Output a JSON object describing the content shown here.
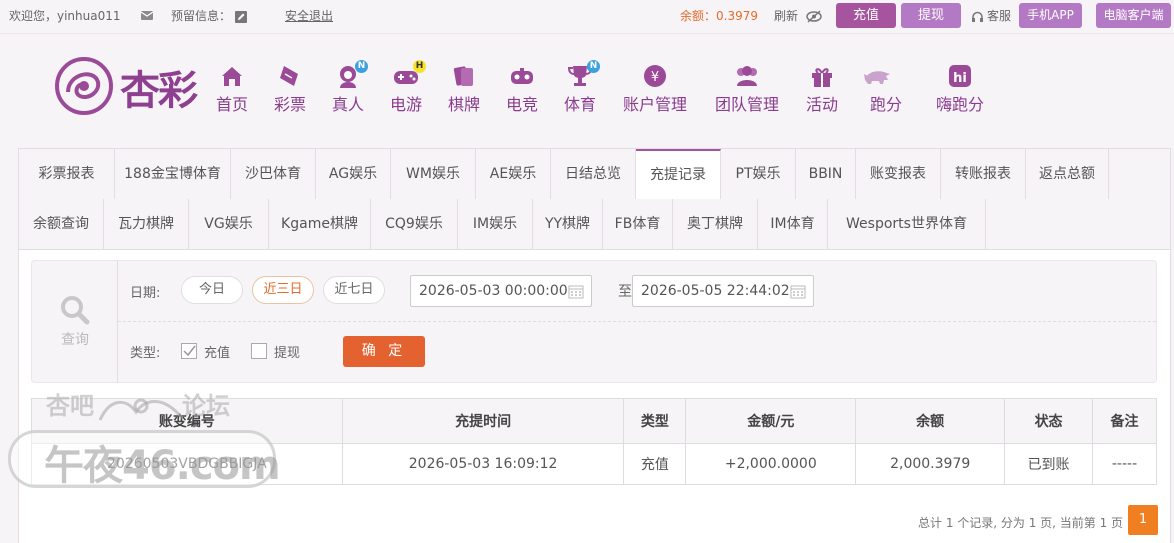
{
  "topbar": {
    "welcome": "欢迎您，yinhua011",
    "reserved_info": "预留信息：",
    "logout": "安全退出",
    "balance_label": "余额：",
    "balance_value": "0.3979",
    "refresh": "刷新",
    "deposit_btn": "充值",
    "withdraw_btn": "提现",
    "service": "客服",
    "mobile_app": "手机APP",
    "pc_client": "电脑客户端"
  },
  "brand": {
    "name": "杏彩"
  },
  "nav": [
    {
      "label": "首页",
      "icon": "home-icon"
    },
    {
      "label": "彩票",
      "icon": "ticket-icon"
    },
    {
      "label": "真人",
      "icon": "dealer-icon",
      "badge": "N"
    },
    {
      "label": "电游",
      "icon": "gamepad-icon",
      "badge": "H"
    },
    {
      "label": "棋牌",
      "icon": "cards-icon"
    },
    {
      "label": "电竞",
      "icon": "controller-icon"
    },
    {
      "label": "体育",
      "icon": "trophy-icon",
      "badge": "N"
    },
    {
      "label": "账户管理",
      "icon": "yen-coin-icon"
    },
    {
      "label": "团队管理",
      "icon": "team-icon"
    },
    {
      "label": "活动",
      "icon": "gift-icon"
    },
    {
      "label": "跑分",
      "icon": "rhino-icon"
    },
    {
      "label": "嗨跑分",
      "icon": "hi-icon"
    }
  ],
  "tabs_row1": [
    "彩票报表",
    "188金宝博体育",
    "沙巴体育",
    "AG娱乐",
    "WM娱乐",
    "AE娱乐",
    "日结总览",
    "充提记录",
    "PT娱乐",
    "BBIN",
    "账变报表",
    "转账报表",
    "返点总额"
  ],
  "tabs_row2": [
    "余额查询",
    "瓦力棋牌",
    "VG娱乐",
    "Kgame棋牌",
    "CQ9娱乐",
    "IM娱乐",
    "YY棋牌",
    "FB体育",
    "奥丁棋牌",
    "IM体育",
    "Wesports世界体育"
  ],
  "active_tab": "充提记录",
  "filter": {
    "query_label": "查询",
    "date_label": "日期:",
    "quick_dates": [
      "今日",
      "近三日",
      "近七日"
    ],
    "active_quick": "近三日",
    "start": "2026-05-03 00:00:00",
    "to": "至",
    "end": "2026-05-05 22:44:02",
    "type_label": "类型:",
    "type_options": [
      {
        "label": "充值",
        "checked": true
      },
      {
        "label": "提现",
        "checked": false
      }
    ],
    "confirm": "确 定"
  },
  "table": {
    "headers": [
      "账变编号",
      "充提时间",
      "类型",
      "金额/元",
      "余额",
      "状态",
      "备注"
    ],
    "rows": [
      [
        "20260503VBDGBBIGJA",
        "2026-05-03 16:09:12",
        "充值",
        "+2,000.0000",
        "2,000.3979",
        "已到账",
        "-----"
      ]
    ]
  },
  "pagination": {
    "info": "总计 1 个记录, 分为 1 页, 当前第 1 页",
    "current": "1"
  },
  "watermark": {
    "top_left": "杏吧",
    "top_right": "论坛",
    "main": "午夜46.com"
  },
  "colors": {
    "primary": "#a5549d",
    "accent": "#e4622f",
    "amount": "#d8131a",
    "status_ok": "#34a12a"
  }
}
